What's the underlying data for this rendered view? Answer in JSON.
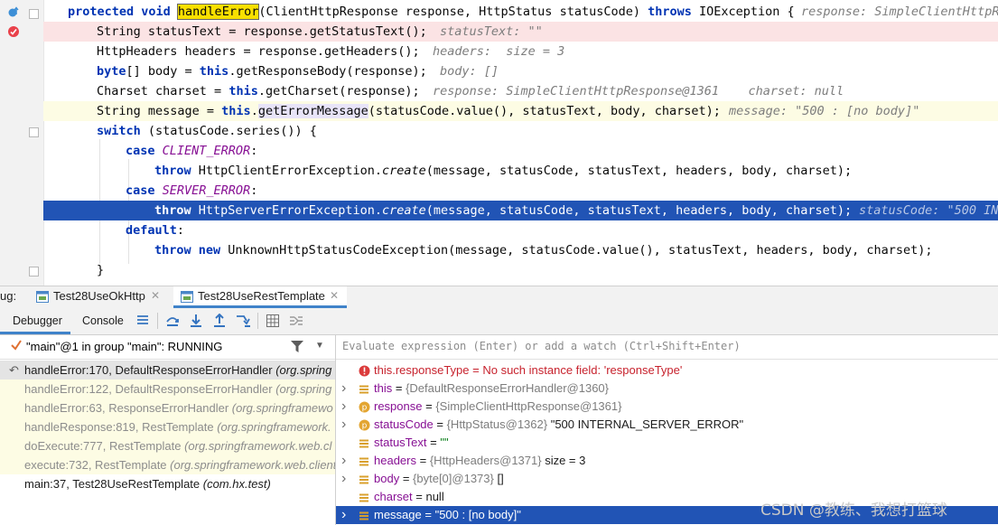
{
  "editor": {
    "lines": [
      {
        "parts": [
          [
            "kw",
            "protected void "
          ],
          [
            "hlw",
            "handleError"
          ],
          [
            "n",
            "(ClientHttpResponse response, HttpStatus statusCode) "
          ],
          [
            "kw",
            "throws "
          ],
          [
            "n",
            "IOException {"
          ]
        ],
        "hint": "response: SimpleClientHttpRe"
      },
      {
        "parts": [
          [
            "n",
            "String statusText = response.getStatusText();"
          ]
        ],
        "hint": "statusText: \"\""
      },
      {
        "parts": [
          [
            "n",
            "HttpHeaders headers = response.getHeaders();"
          ]
        ],
        "hint": "headers:  size = 3"
      },
      {
        "parts": [
          [
            "kw",
            "byte"
          ],
          [
            "n",
            "[] body = "
          ],
          [
            "kw",
            "this"
          ],
          [
            "n",
            ".getResponseBody(response);"
          ]
        ],
        "hint": "body: []"
      },
      {
        "parts": [
          [
            "n",
            "Charset charset = "
          ],
          [
            "kw",
            "this"
          ],
          [
            "n",
            ".getCharset(response);"
          ]
        ],
        "hint": "response: SimpleClientHttpResponse@1361    charset: null"
      },
      {
        "parts": [
          [
            "n",
            "String message = "
          ],
          [
            "kw",
            "this"
          ],
          [
            "n",
            "."
          ],
          [
            "hls",
            "getErrorMessage"
          ],
          [
            "n",
            "(statusCode.value(), statusText, body, charset);"
          ]
        ],
        "hint": "message: \"500 : [no body]\""
      },
      {
        "parts": [
          [
            "kw",
            "switch "
          ],
          [
            "n",
            "(statusCode.series()) {"
          ]
        ],
        "hint": ""
      },
      {
        "parts": [
          [
            "kw",
            "case "
          ],
          [
            "em",
            "CLIENT_ERROR"
          ],
          [
            "n",
            ":"
          ]
        ],
        "hint": ""
      },
      {
        "parts": [
          [
            "kw",
            "throw "
          ],
          [
            "n",
            "HttpClientErrorException."
          ],
          [
            "it",
            "create"
          ],
          [
            "n",
            "(message, statusCode, statusText, headers, body, charset);"
          ]
        ],
        "hint": ""
      },
      {
        "parts": [
          [
            "kw",
            "case "
          ],
          [
            "em",
            "SERVER_ERROR"
          ],
          [
            "n",
            ":"
          ]
        ],
        "hint": ""
      },
      {
        "parts": [
          [
            "kw",
            "throw "
          ],
          [
            "n",
            "HttpServerErrorException."
          ],
          [
            "it",
            "create"
          ],
          [
            "n",
            "(message, statusCode, statusText, headers, body, charset);"
          ]
        ],
        "hint": "statusCode: \"500 IN"
      },
      {
        "parts": [
          [
            "kw",
            "default"
          ],
          [
            "n",
            ":"
          ]
        ],
        "hint": ""
      },
      {
        "parts": [
          [
            "kw",
            "throw new "
          ],
          [
            "n",
            "UnknownHttpStatusCodeException(message, statusCode.value(), statusText, headers, body, charset);"
          ]
        ],
        "hint": ""
      },
      {
        "parts": [
          [
            "n",
            "}"
          ]
        ],
        "hint": ""
      }
    ]
  },
  "debug_tabs": {
    "prefix": "ug:",
    "tabs": [
      {
        "label": "Test28UseOkHttp",
        "active": false
      },
      {
        "label": "Test28UseRestTemplate",
        "active": true
      }
    ]
  },
  "toolbar": {
    "debugger_label": "Debugger",
    "console_label": "Console"
  },
  "frames": {
    "thread_text": "\"main\"@1 in group \"main\": RUNNING",
    "rows": [
      {
        "method": "handleError:170, DefaultResponseErrorHandler",
        "pkg": "(org.spring",
        "state": "current"
      },
      {
        "method": "handleError:122, DefaultResponseErrorHandler",
        "pkg": "(org.spring",
        "state": "library"
      },
      {
        "method": "handleError:63, ResponseErrorHandler",
        "pkg": "(org.springframewo",
        "state": "library"
      },
      {
        "method": "handleResponse:819, RestTemplate",
        "pkg": "(org.springframework.",
        "state": "library"
      },
      {
        "method": "doExecute:777, RestTemplate",
        "pkg": "(org.springframework.web.cl",
        "state": "library"
      },
      {
        "method": "execute:732, RestTemplate",
        "pkg": "(org.springframework.web.client",
        "state": "library"
      },
      {
        "method": "main:37, Test28UseRestTemplate",
        "pkg": "(com.hx.test)",
        "state": "user"
      }
    ]
  },
  "vars": {
    "eval_placeholder": "Evaluate expression (Enter) or add a watch (Ctrl+Shift+Enter)",
    "rows": [
      {
        "icon": "error",
        "expand": false,
        "name": "this.responseType",
        "eq": " = ",
        "ref": "",
        "value": "No such instance field: 'responseType'",
        "vclass": "err"
      },
      {
        "icon": "field",
        "expand": true,
        "name": "this",
        "eq": " = ",
        "ref": "{DefaultResponseErrorHandler@1360}",
        "value": "",
        "vclass": ""
      },
      {
        "icon": "param",
        "expand": true,
        "name": "response",
        "eq": " = ",
        "ref": "{SimpleClientHttpResponse@1361}",
        "value": "",
        "vclass": ""
      },
      {
        "icon": "param",
        "expand": true,
        "name": "statusCode",
        "eq": " = ",
        "ref": "{HttpStatus@1362}",
        "value": " \"500 INTERNAL_SERVER_ERROR\"",
        "vclass": "plain"
      },
      {
        "icon": "field",
        "expand": false,
        "name": "statusText",
        "eq": " = ",
        "ref": "",
        "value": "\"\"",
        "vclass": "str"
      },
      {
        "icon": "field",
        "expand": true,
        "name": "headers",
        "eq": " = ",
        "ref": "{HttpHeaders@1371}",
        "value": "  size = 3",
        "vclass": "plain"
      },
      {
        "icon": "field",
        "expand": true,
        "name": "body",
        "eq": " = ",
        "ref": "{byte[0]@1373}",
        "value": " []",
        "vclass": "plain"
      },
      {
        "icon": "field",
        "expand": false,
        "name": "charset",
        "eq": " = ",
        "ref": "",
        "value": "null",
        "vclass": "plain"
      },
      {
        "icon": "field",
        "expand": true,
        "name": "message",
        "eq": " = ",
        "ref": "",
        "value": "\"500 : [no body]\"",
        "vclass": "sel"
      }
    ]
  },
  "watermark": "CSDN @教练、我想打篮球",
  "colors": {
    "exec_line": "#2154b5",
    "breakpoint": "#e9414a",
    "current_frame_bg": "#e4e4e4",
    "library_frame_bg": "#fdfce4",
    "selected_var_bg": "#2154b5"
  }
}
